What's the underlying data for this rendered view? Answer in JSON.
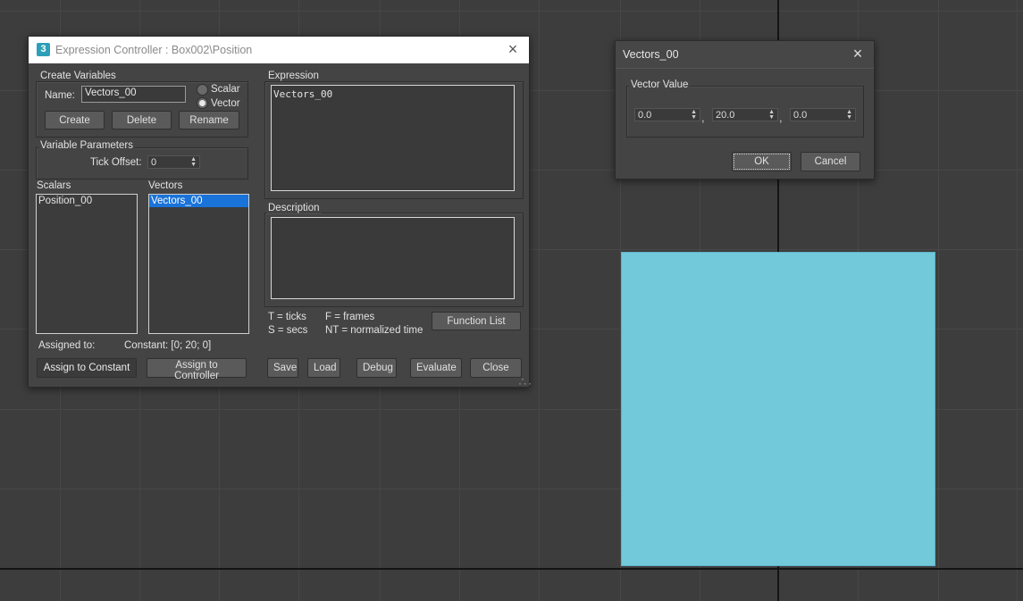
{
  "expression_controller": {
    "title": "Expression Controller : Box002\\Position",
    "app_icon": "3",
    "create_variables": {
      "group_label": "Create Variables",
      "name_label": "Name:",
      "name_value": "Vectors_00",
      "scalar_label": "Scalar",
      "vector_label": "Vector",
      "selected_type": "Vector",
      "create_button": "Create",
      "delete_button": "Delete",
      "rename_button": "Rename"
    },
    "variable_parameters": {
      "group_label": "Variable Parameters",
      "tick_offset_label": "Tick Offset:",
      "tick_offset_value": "0"
    },
    "scalars": {
      "label": "Scalars",
      "items": [
        "Position_00"
      ]
    },
    "vectors": {
      "label": "Vectors",
      "items": [
        "Vectors_00"
      ],
      "selected": "Vectors_00"
    },
    "assigned_to_label": "Assigned to:",
    "assigned_to_value": "Constant: [0; 20; 0]",
    "assign_constant_button": "Assign to Constant",
    "assign_controller_button": "Assign to Controller",
    "expression": {
      "label": "Expression",
      "text": "Vectors_00"
    },
    "description": {
      "label": "Description",
      "text": ""
    },
    "legend": {
      "t": "T = ticks",
      "s": "S = secs",
      "f": "F = frames",
      "nt": "NT = normalized time"
    },
    "function_list_button": "Function List",
    "save_button": "Save",
    "load_button": "Load",
    "debug_button": "Debug",
    "evaluate_button": "Evaluate",
    "close_button": "Close"
  },
  "vector_dialog": {
    "title": "Vectors_00",
    "group_label": "Vector Value",
    "x_value": "0.0",
    "y_value": "20.0",
    "z_value": "0.0",
    "separator": ",",
    "ok_button": "OK",
    "cancel_button": "Cancel"
  },
  "icons": {
    "close": "×",
    "spinner": "▲▼",
    "resize_grip": "resize-grip-icon"
  }
}
